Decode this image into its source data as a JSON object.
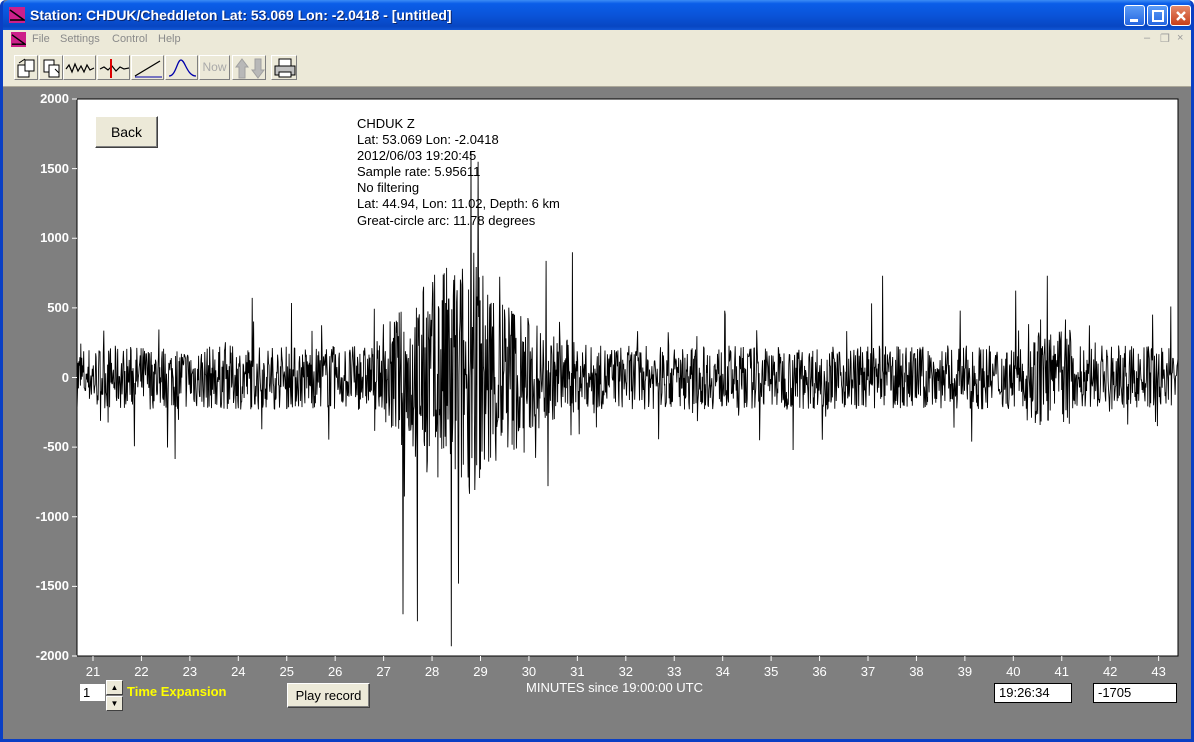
{
  "window": {
    "title": "Station: CHDUK/Cheddleton Lat: 53.069 Lon: -2.0418 - [untitled]"
  },
  "menu": {
    "items": [
      {
        "label": "File"
      },
      {
        "label": "Settings"
      },
      {
        "label": "Control"
      },
      {
        "label": "Help"
      }
    ]
  },
  "toolbar": {
    "now_label": "Now",
    "buttons": [
      "open-icon",
      "save-icon",
      "waveform-icon",
      "pick-marker-icon",
      "slope-icon",
      "spectrum-icon",
      "now-button",
      "up-down-arrows-icon",
      "printer-icon"
    ]
  },
  "plot": {
    "back_label": "Back",
    "info_lines": [
      "CHDUK  Z",
      "Lat: 53.069 Lon: -2.0418",
      "2012/06/03 19:20:45",
      "Sample rate: 5.95611",
      "No filtering",
      "Lat: 44.94, Lon: 11.02, Depth: 6 km",
      "Great-circle arc: 11.78 degrees"
    ],
    "trace_color": "#000000",
    "background_color": "#ffffff"
  },
  "chart_data": {
    "type": "line",
    "ylim": [
      -2000,
      2000
    ],
    "xlim": [
      20.67,
      43.4
    ],
    "y_ticks": [
      "2000",
      "1500",
      "1000",
      "500",
      "0",
      "-500",
      "-1000",
      "-1500",
      "-2000"
    ],
    "x_ticks": [
      "21",
      "22",
      "23",
      "24",
      "25",
      "26",
      "27",
      "28",
      "29",
      "30",
      "31",
      "32",
      "33",
      "34",
      "35",
      "36",
      "37",
      "38",
      "39",
      "40",
      "41",
      "42",
      "43"
    ],
    "xlabel": "MINUTES since 19:00:00 UTC",
    "peaks": [
      {
        "x": 27.4,
        "y": -1700
      },
      {
        "x": 27.7,
        "y": -1750
      },
      {
        "x": 28.4,
        "y": -1930
      },
      {
        "x": 28.55,
        "y": -1480
      },
      {
        "x": 28.8,
        "y": 1620
      },
      {
        "x": 28.95,
        "y": 1550
      },
      {
        "x": 30.9,
        "y": 900
      },
      {
        "x": 37.3,
        "y": 730
      },
      {
        "x": 40.7,
        "y": 730
      }
    ]
  },
  "bottom": {
    "expansion_value": "1",
    "expansion_label": "Time Expansion",
    "play_label": "Play record",
    "time_readout": "19:26:34",
    "value_readout": "-1705"
  }
}
